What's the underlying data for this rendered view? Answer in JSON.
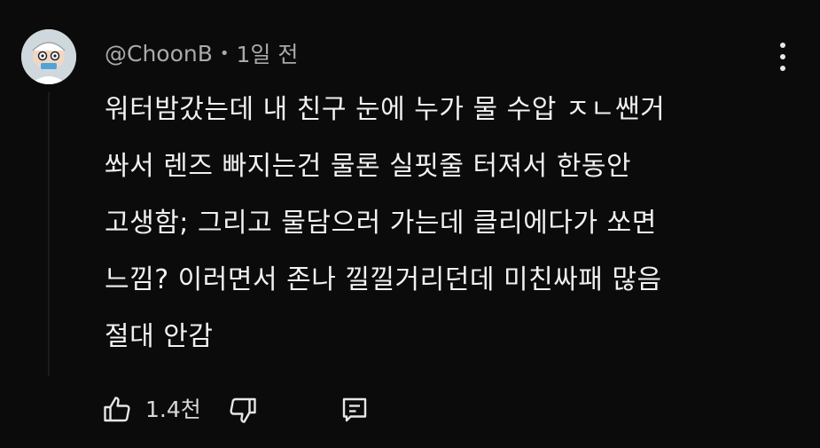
{
  "comment": {
    "author": "@ChoonB",
    "separator": "•",
    "time": "1일 전",
    "text_lines": [
      "워터밤갔는데 내 친구 눈에 누가 물 수압 ㅈㄴ쌘거",
      "쏴서 렌즈 빠지는건 물론 실핏줄 터져서 한동안",
      "고생함; 그리고 물담으러 가는데 클리에다가 쏘면",
      "느낌? 이러면서 존나 낄낄거리던데 미친싸패 많음",
      "절대 안감"
    ],
    "like_count": "1.4천"
  },
  "icons": {
    "avatar": "avatar-cartoon-icon",
    "menu": "more-vertical-icon",
    "like": "thumb-up-icon",
    "dislike": "thumb-down-icon",
    "reply": "comment-reply-icon"
  },
  "colors": {
    "background": "#0b0b0b",
    "text_primary": "#f1f1f1",
    "text_secondary": "#aaaaaa"
  }
}
